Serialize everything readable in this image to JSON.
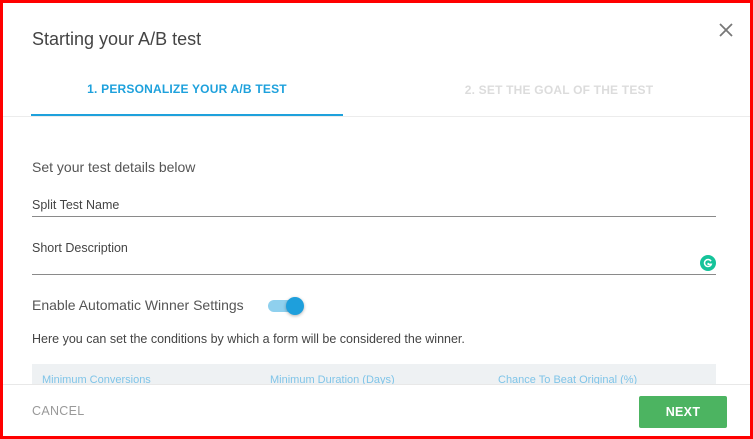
{
  "dialog": {
    "title": "Starting your A/B test",
    "close_icon": "close-icon"
  },
  "tabs": [
    {
      "label": "1. PERSONALIZE YOUR A/B TEST",
      "active": true
    },
    {
      "label": "2. SET THE GOAL OF THE TEST",
      "active": false
    }
  ],
  "form": {
    "subtitle": "Set your test details below",
    "name_field": {
      "label": "Split Test Name",
      "value": ""
    },
    "description_field": {
      "label": "Short Description",
      "value": "",
      "addon_icon": "grammarly-icon"
    },
    "auto_winner": {
      "label": "Enable Automatic Winner Settings",
      "enabled": true
    },
    "conditions_text": "Here you can set the conditions by which a form will be considered the winner.",
    "conditions_columns": [
      "Minimum Conversions",
      "Minimum Duration (Days)",
      "Chance To Beat Original (%)"
    ]
  },
  "footer": {
    "cancel_label": "CANCEL",
    "next_label": "NEXT"
  },
  "colors": {
    "accent": "#1ea1dc",
    "primary_button": "#4cb461",
    "frame_border": "#ff0000"
  }
}
